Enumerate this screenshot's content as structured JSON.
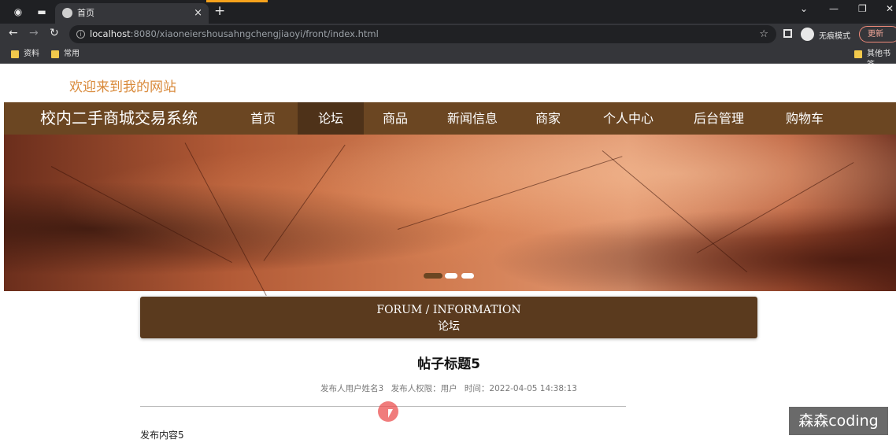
{
  "browser": {
    "tab_title": "首页",
    "tab_close": "×",
    "new_tab": "+",
    "url_host": "localhost",
    "url_path": ":8080/xiaoneiershousahngchengjiaoyi/front/index.html",
    "incognito_label": "无痕模式",
    "update_label": "更新",
    "bookmarks": [
      "资料",
      "常用"
    ],
    "other_bookmarks": "其他书签"
  },
  "site": {
    "welcome": "欢迎来到我的网站",
    "brand": "校内二手商城交易系统",
    "nav": [
      {
        "label": "首页",
        "active": false
      },
      {
        "label": "论坛",
        "active": true
      },
      {
        "label": "商品",
        "active": false
      },
      {
        "label": "新闻信息",
        "active": false
      },
      {
        "label": "商家",
        "active": false
      },
      {
        "label": "个人中心",
        "active": false
      },
      {
        "label": "后台管理",
        "active": false
      },
      {
        "label": "购物车",
        "active": false
      }
    ],
    "carousel": {
      "dots": 3,
      "active_index": 0
    }
  },
  "forum": {
    "heading_en": "FORUM / INFORMATION",
    "heading_cn": "论坛"
  },
  "post": {
    "title": "帖子标题5",
    "author": "发布人用户姓名3",
    "role": "发布人权限：用户",
    "time": "时间：2022-04-05 14:38:13",
    "content": "发布内容5"
  },
  "watermark": "森森coding",
  "colors": {
    "nav_bg": "#6b4622",
    "nav_active": "#4e3219",
    "welcome": "#d98a3b",
    "forum_box": "#5a3a1e"
  }
}
